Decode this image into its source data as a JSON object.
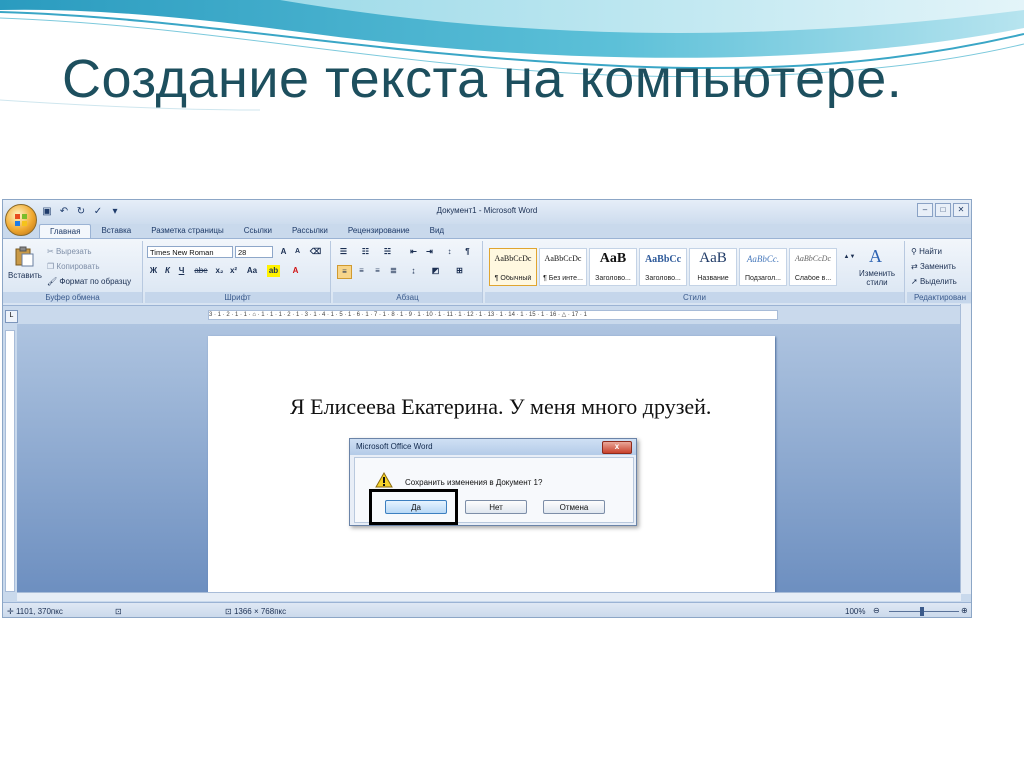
{
  "slide": {
    "title": "Создание текста на компьютере."
  },
  "word": {
    "window_title": "Документ1 - Microsoft Word",
    "tabs": [
      "Главная",
      "Вставка",
      "Разметка страницы",
      "Ссылки",
      "Рассылки",
      "Рецензирование",
      "Вид"
    ],
    "active_tab": "Главная",
    "clipboard": {
      "paste": "Вставить",
      "cut": "Вырезать",
      "copy": "Копировать",
      "format_painter": "Формат по образцу",
      "label": "Буфер обмена"
    },
    "font": {
      "name": "Times New Roman",
      "size": "28",
      "label": "Шрифт",
      "bold": "Ж",
      "italic": "К",
      "underline": "Ч",
      "strike": "abe",
      "subscript": "x₂",
      "superscript": "x²",
      "change_case": "Aa",
      "grow": "A",
      "shrink": "A"
    },
    "paragraph": {
      "label": "Абзац",
      "pilcrow": "¶"
    },
    "styles": {
      "label": "Стили",
      "items": [
        {
          "preview": "AaBbCcDc",
          "name": "¶ Обычный"
        },
        {
          "preview": "AaBbCcDc",
          "name": "¶ Без инте..."
        },
        {
          "preview": "AaB",
          "name": "Заголово..."
        },
        {
          "preview": "AaBbCc",
          "name": "Заголово..."
        },
        {
          "preview": "AaB",
          "name": "Название"
        },
        {
          "preview": "AaBbCc.",
          "name": "Подзагол..."
        },
        {
          "preview": "AaBbCcDc",
          "name": "Слабое в..."
        }
      ],
      "change_styles": "Изменить стили"
    },
    "editing": {
      "label": "Редактирован",
      "find": "Найти",
      "replace": "Заменить",
      "select": "Выделить"
    },
    "ruler_marks": "3 · 1 · 2 · 1 · 1 · ⌂ · 1 · 1 · 1 · 2 · 1 · 3 · 1 · 4 · 1 · 5 · 1 · 6 · 1 · 7 · 1 · 8 · 1 · 9 · 1 · 10 · 1 · 11 · 1 · 12 · 1 · 13 · 1 · 14 · 1 · 15 · 1 · 16 · △ · 17 · 1",
    "document": {
      "text": "Я Елисеева Екатерина. У меня много друзей."
    },
    "dialog": {
      "title": "Microsoft Office Word",
      "close": "x",
      "message": "Сохранить изменения в Документ 1?",
      "yes": "Да",
      "no": "Нет",
      "cancel": "Отмена"
    },
    "status": {
      "cursor": "1101, 370пкс",
      "dimensions": "1366 × 768пкс",
      "zoom": "100%"
    }
  }
}
